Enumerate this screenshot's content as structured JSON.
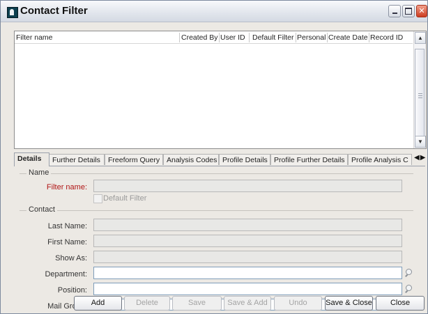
{
  "window": {
    "title": "Contact Filter"
  },
  "grid": {
    "columns": [
      "Filter name",
      "Created By",
      "User ID",
      "Default Filter",
      "Personal",
      "Create Date",
      "Record ID"
    ],
    "rows": []
  },
  "tabs": {
    "items": [
      "Details",
      "Further Details",
      "Freeform Query",
      "Analysis Codes",
      "Profile Details",
      "Profile Further Details",
      "Profile Analysis C"
    ],
    "active": "Details"
  },
  "sections": {
    "name": "Name",
    "contact": "Contact"
  },
  "fields": {
    "filter_name": {
      "label": "Filter name:",
      "value": ""
    },
    "default_filter": {
      "label": "Default Filter",
      "checked": false
    },
    "last_name": {
      "label": "Last Name:",
      "value": ""
    },
    "first_name": {
      "label": "First Name:",
      "value": ""
    },
    "show_as": {
      "label": "Show As:",
      "value": ""
    },
    "department": {
      "label": "Department:",
      "value": ""
    },
    "position": {
      "label": "Position:",
      "value": ""
    },
    "mail_group": {
      "label": "Mail Group:",
      "value": ""
    }
  },
  "buttons": {
    "add": "Add",
    "delete": "Delete",
    "save": "Save",
    "save_add": "Save & Add",
    "undo": "Undo",
    "save_close": "Save & Close",
    "close": "Close"
  },
  "icons": {
    "app": "app-icon",
    "lookup": "magnifier-icon"
  }
}
